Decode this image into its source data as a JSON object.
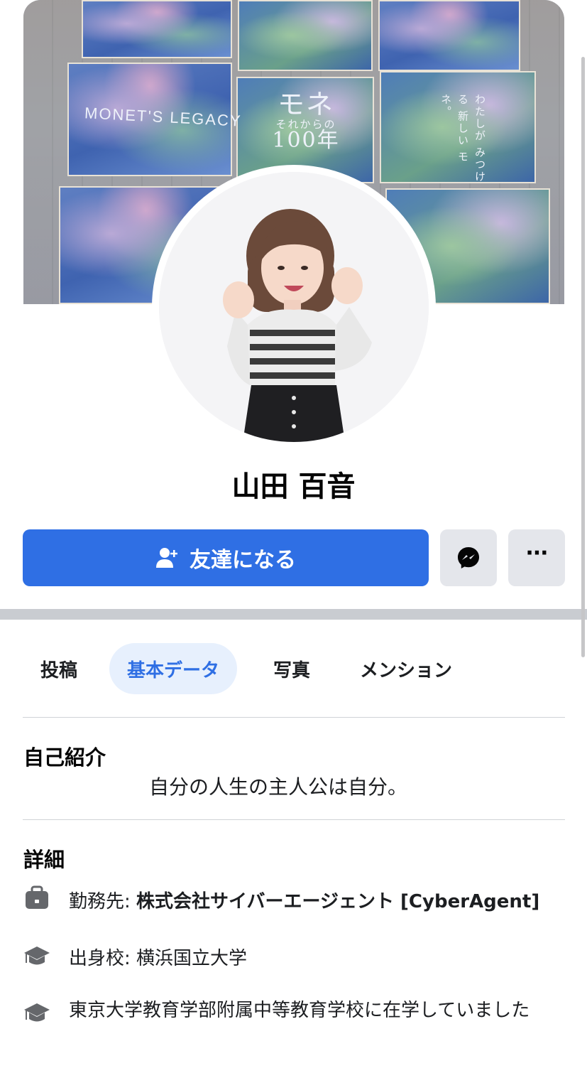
{
  "cover": {
    "left_sign": "MONET'S LEGACY",
    "center_line1": "モネ",
    "center_line2": "それからの",
    "center_line3": "100年",
    "right_vertical": "わたしが みつける 新しい モネ。"
  },
  "profile": {
    "name": "山田 百音"
  },
  "actions": {
    "add_friend_label": "友達になる",
    "more_label": "···"
  },
  "tabs": [
    {
      "label": "投稿",
      "active": false
    },
    {
      "label": "基本データ",
      "active": true
    },
    {
      "label": "写真",
      "active": false
    },
    {
      "label": "メンション",
      "active": false
    }
  ],
  "intro": {
    "title": "自己紹介",
    "bio": "自分の人生の主人公は自分。"
  },
  "details": {
    "title": "詳細",
    "work_prefix": "勤務先: ",
    "work_value": "株式会社サイバーエージェント [CyberAgent]",
    "school": "出身校: 横浜国立大学",
    "study": "東京大学教育学部附属中等教育学校に在学していました"
  },
  "colors": {
    "primary": "#2f6fe4",
    "tab_active_bg": "#e7f0fd",
    "secondary_button": "#e4e6eb",
    "icon": "#65676b"
  }
}
